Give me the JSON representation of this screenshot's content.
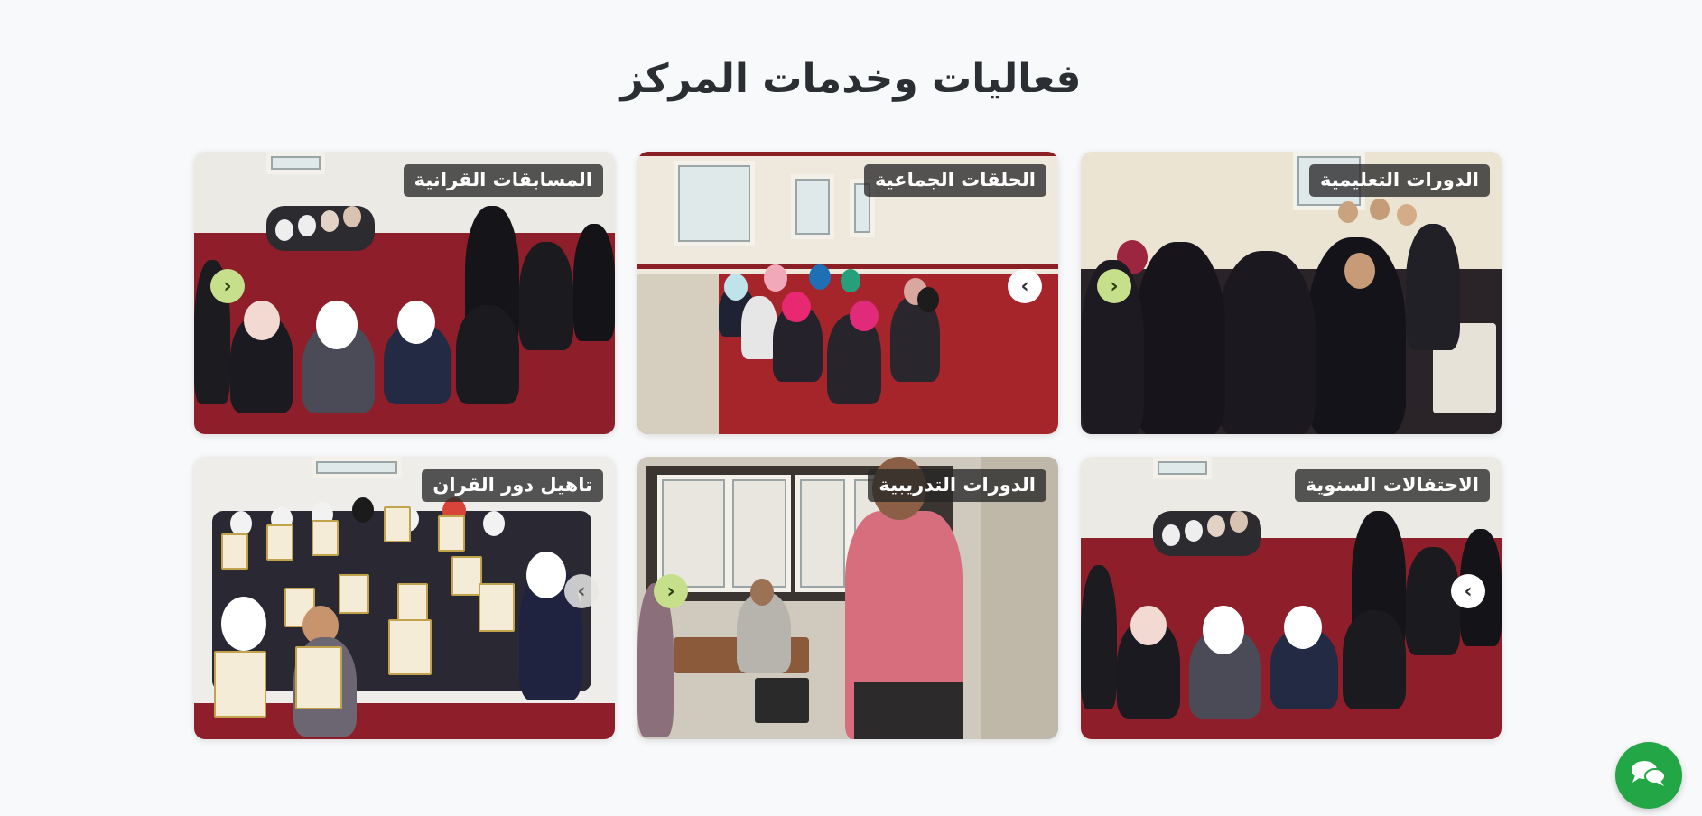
{
  "section": {
    "title": "فعاليات وخدمات المركز"
  },
  "cards": [
    {
      "caption": "الدورات التعليمية"
    },
    {
      "caption": "الحلقات الجماعية"
    },
    {
      "caption": "المسابقات القرانية"
    },
    {
      "caption": "الاحتفالات السنوية"
    },
    {
      "caption": "الدورات التدريبية"
    },
    {
      "caption": "تاهيل دور القران"
    }
  ],
  "icons": {
    "arrow": "chevron-icon",
    "chat": "chat-bubbles-icon"
  },
  "colors": {
    "background": "#f8f9fb",
    "title": "#2b2f33",
    "caption_bg": "#282828",
    "chat_button": "#22a646",
    "arrow_accent": "#c6df8a"
  }
}
